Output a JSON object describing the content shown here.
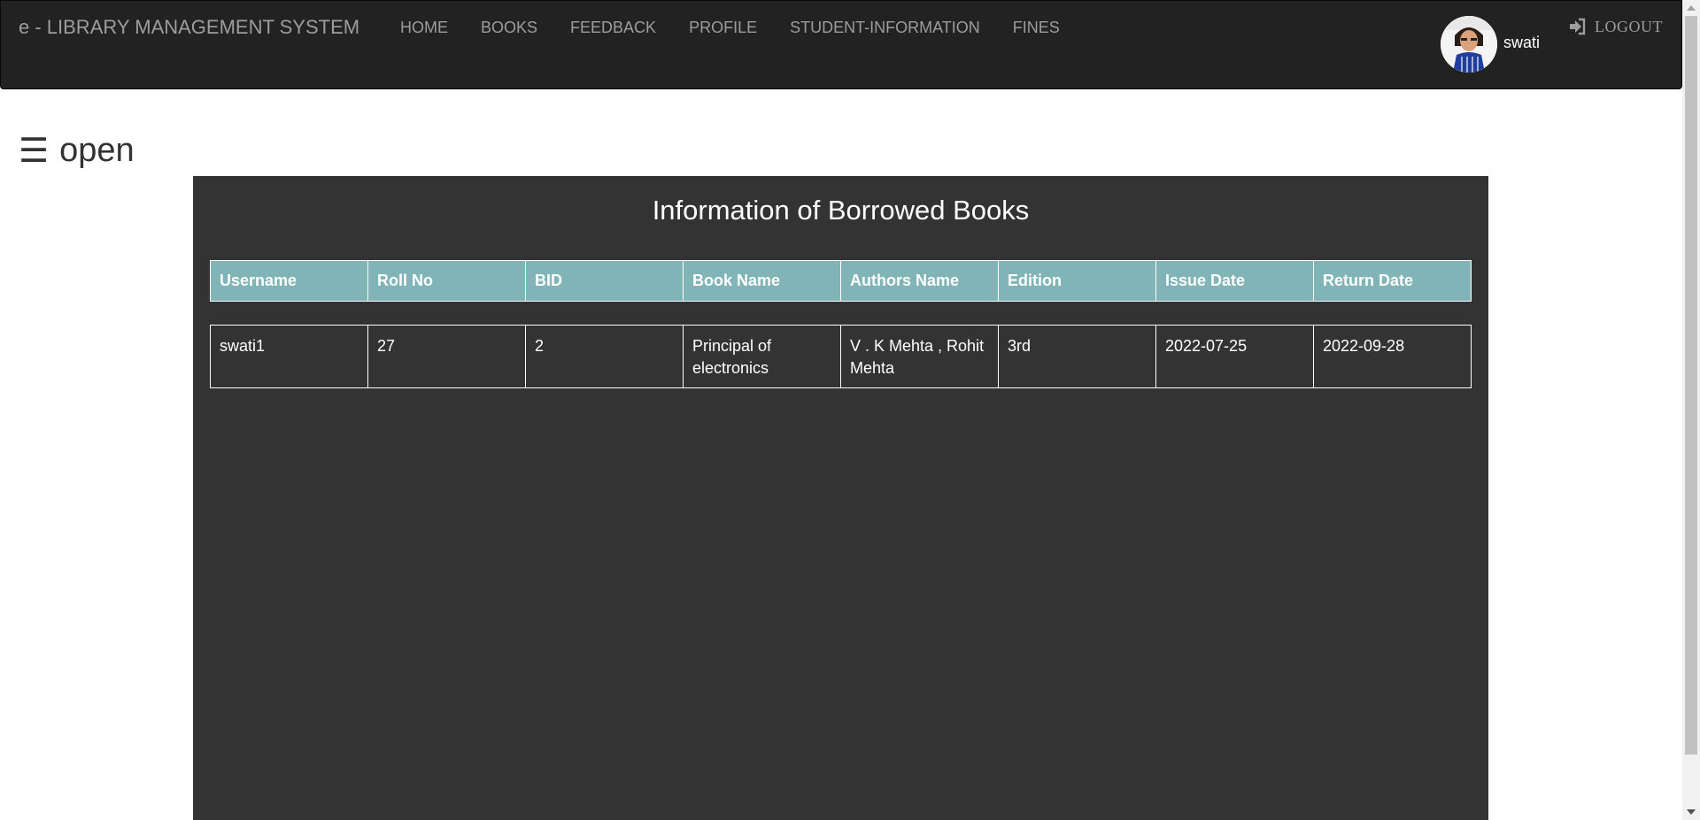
{
  "navbar": {
    "brand": "e - LIBRARY MANAGEMENT SYSTEM",
    "links": [
      "HOME",
      "BOOKS",
      "FEEDBACK",
      "PROFILE",
      "STUDENT-INFORMATION",
      "FINES"
    ],
    "user_name": "swati",
    "logout_label": "LOGOUT"
  },
  "sidebar_toggle": {
    "glyph": "☰",
    "label": "open"
  },
  "panel": {
    "title": "Information of Borrowed Books",
    "columns": [
      "Username",
      "Roll No",
      "BID",
      "Book Name",
      "Authors Name",
      "Edition",
      "Issue Date",
      "Return Date"
    ],
    "rows": [
      [
        "swati1",
        "27",
        "2",
        "Principal of electronics",
        "V . K Mehta , Rohit Mehta",
        "3rd",
        "2022-07-25",
        "2022-09-28"
      ]
    ]
  },
  "icons": {
    "logout": "logout-icon",
    "avatar": "user-avatar"
  },
  "colors": {
    "navbar": "#222222",
    "panel": "#333333",
    "table_header": "#80b4b6"
  }
}
